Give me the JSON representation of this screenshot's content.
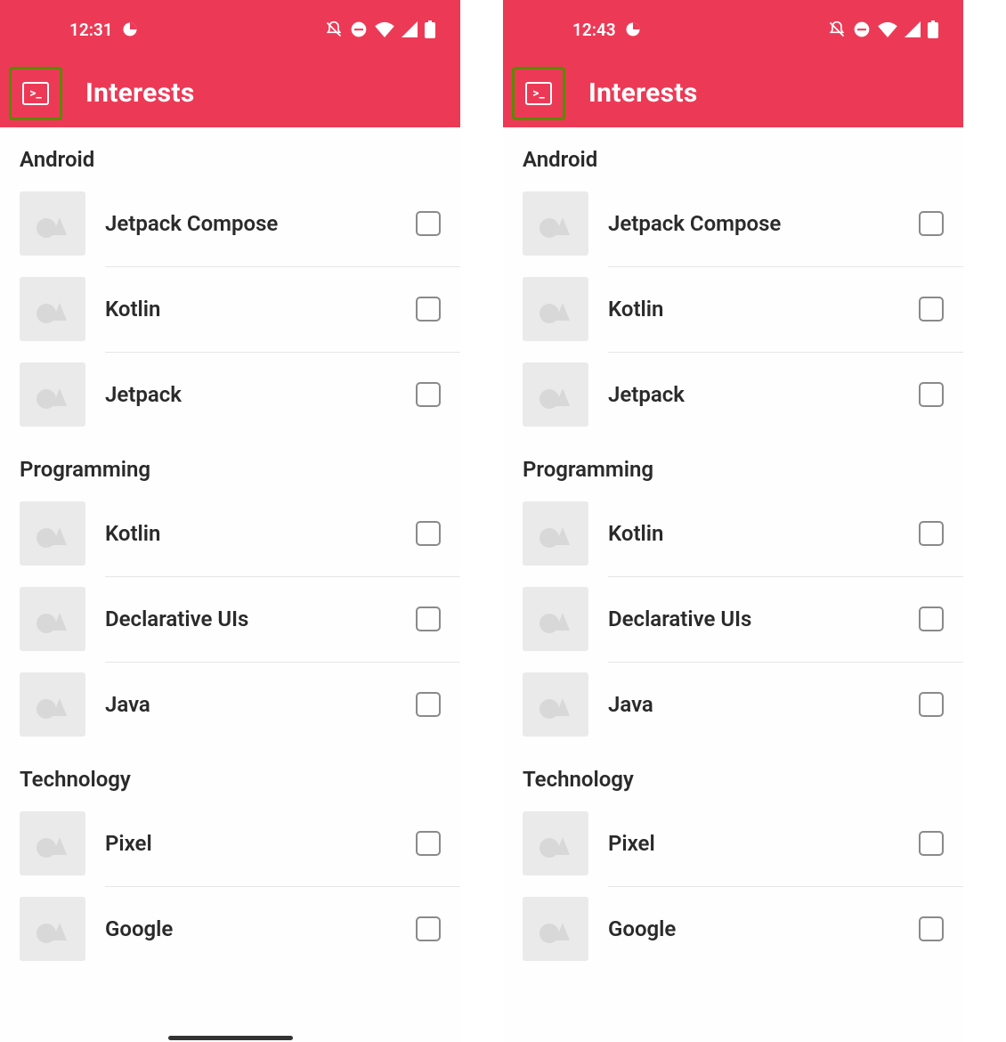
{
  "accent": "#ec3a56",
  "highlight_border": "#5a8a00",
  "screens": [
    {
      "status": {
        "time": "12:31"
      },
      "title": "Interests",
      "sections": [
        {
          "header": "Android",
          "items": [
            "Jetpack Compose",
            "Kotlin",
            "Jetpack"
          ]
        },
        {
          "header": "Programming",
          "items": [
            "Kotlin",
            "Declarative UIs",
            "Java"
          ]
        },
        {
          "header": "Technology",
          "items": [
            "Pixel",
            "Google"
          ]
        }
      ]
    },
    {
      "status": {
        "time": "12:43"
      },
      "title": "Interests",
      "sections": [
        {
          "header": "Android",
          "items": [
            "Jetpack Compose",
            "Kotlin",
            "Jetpack"
          ]
        },
        {
          "header": "Programming",
          "items": [
            "Kotlin",
            "Declarative UIs",
            "Java"
          ]
        },
        {
          "header": "Technology",
          "items": [
            "Pixel",
            "Google"
          ]
        }
      ]
    }
  ]
}
